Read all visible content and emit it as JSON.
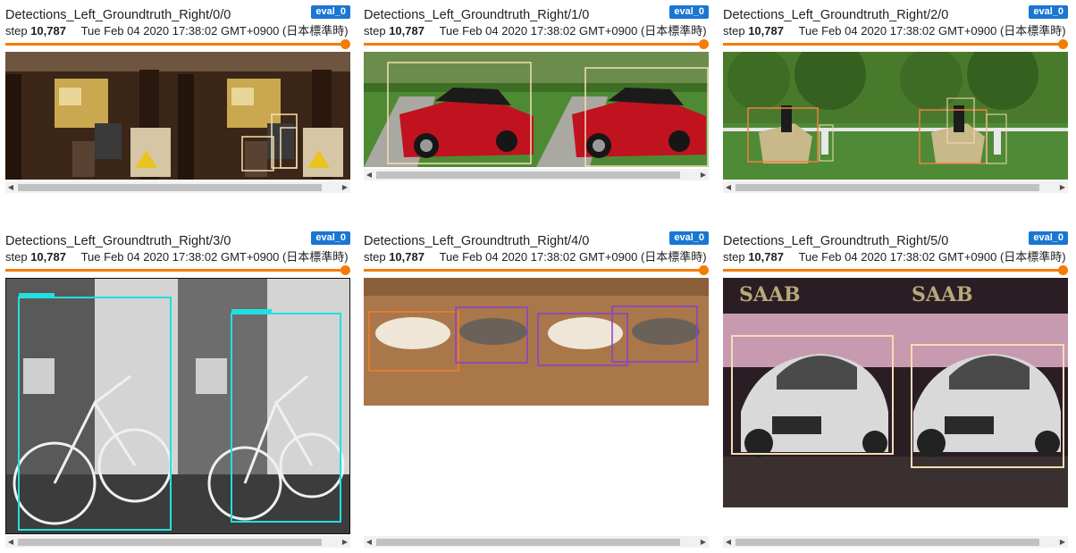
{
  "cards": [
    {
      "title": "Detections_Left_Groundtruth_Right/0/0",
      "run": "eval_0",
      "step_label": "step",
      "step": "10,787",
      "timestamp": "Tue Feb 04 2020 17:38:02 GMT+0900 (日本標準時)"
    },
    {
      "title": "Detections_Left_Groundtruth_Right/1/0",
      "run": "eval_0",
      "step_label": "step",
      "step": "10,787",
      "timestamp": "Tue Feb 04 2020 17:38:02 GMT+0900 (日本標準時)"
    },
    {
      "title": "Detections_Left_Groundtruth_Right/2/0",
      "run": "eval_0",
      "step_label": "step",
      "step": "10,787",
      "timestamp": "Tue Feb 04 2020 17:38:02 GMT+0900 (日本標準時)"
    },
    {
      "title": "Detections_Left_Groundtruth_Right/3/0",
      "run": "eval_0",
      "step_label": "step",
      "step": "10,787",
      "timestamp": "Tue Feb 04 2020 17:38:02 GMT+0900 (日本標準時)"
    },
    {
      "title": "Detections_Left_Groundtruth_Right/4/0",
      "run": "eval_0",
      "step_label": "step",
      "step": "10,787",
      "timestamp": "Tue Feb 04 2020 17:38:02 GMT+0900 (日本標準時)"
    },
    {
      "title": "Detections_Left_Groundtruth_Right/5/0",
      "run": "eval_0",
      "step_label": "step",
      "step": "10,787",
      "timestamp": "Tue Feb 04 2020 17:38:02 GMT+0900 (日本標準時)"
    }
  ],
  "image_text": {
    "saab": "SAAB"
  },
  "icons": {
    "scroll_left": "scroll-left-arrow-icon",
    "scroll_right": "scroll-right-arrow-icon"
  },
  "colors": {
    "accent_orange": "#f57c00",
    "run_badge_blue": "#1976d2"
  }
}
